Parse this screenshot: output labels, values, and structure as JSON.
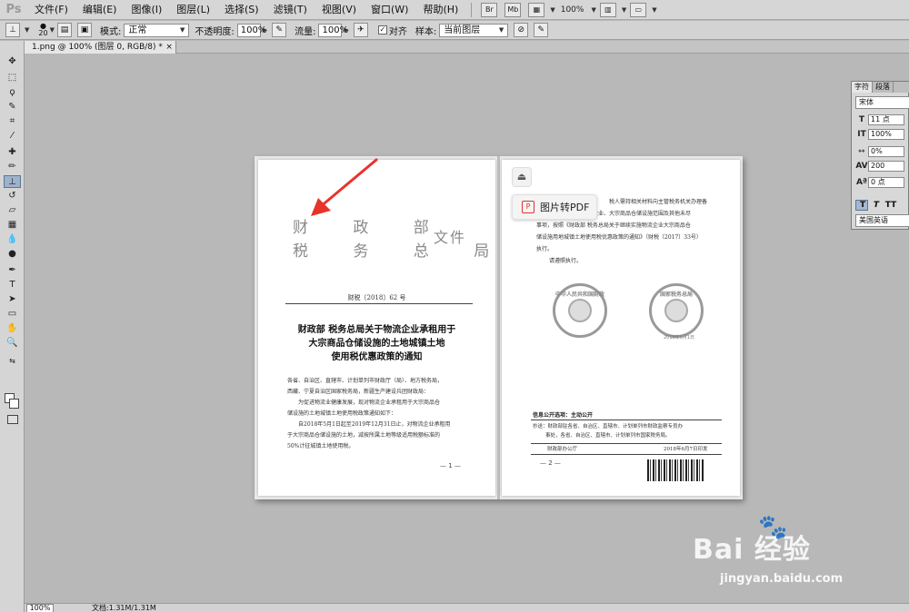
{
  "app": {
    "logo": "Ps"
  },
  "menu": {
    "items": [
      "文件(F)",
      "编辑(E)",
      "图像(I)",
      "图层(L)",
      "选择(S)",
      "滤镜(T)",
      "视图(V)",
      "窗口(W)",
      "帮助(H)"
    ],
    "buttons": [
      "Br",
      "Mb"
    ],
    "zoom": "100%"
  },
  "options": {
    "brush_size": "20",
    "mode_label": "模式:",
    "mode_value": "正常",
    "opacity_label": "不透明度:",
    "opacity_value": "100%",
    "flow_label": "流量:",
    "flow_value": "100%",
    "align_label": "对齐",
    "sample_label": "样本:",
    "sample_value": "当前图层"
  },
  "document_tab": {
    "label": "1.png @ 100% (图层 0, RGB/8) *",
    "close": "×"
  },
  "status": {
    "zoom": "100%",
    "doc_info": "文档:1.31M/1.31M"
  },
  "left_page": {
    "header_line1": "财  政  部",
    "header_line2": "税 务 总 局",
    "header_suffix": "文件",
    "doc_number": "财税〔2018〕62 号",
    "title_lines": [
      "财政部  税务总局关于物流企业承租用于",
      "大宗商品仓储设施的土地城镇土地",
      "使用税优惠政策的通知"
    ],
    "body": [
      "各省、自治区、直辖市、计划单列市财政厅（局）、地方税务局，",
      "西藏、宁夏自治区国家税务局，新疆生产建设兵团财政局：",
      "为促进物流业健康发展，现对物流企业承租用于大宗商品仓",
      "储设施的土地城镇土地使用税政策通知如下：",
      "自2018年5月1日起至2019年12月31日止，对物流企业承租用",
      "于大宗商品仓储设施的土地，减按所属土地等级适用税额标准的",
      "50%计征城镇土地使用税。"
    ],
    "page_number": "— 1 —"
  },
  "right_page": {
    "lines": [
      "税人需持相关材料向主管税务机关办理备",
      "本通知所称的物流企业、大宗商品仓储设施范围及其他未尽",
      "事项，按照《财政部  税务总局关于继续实施物流企业大宗商品仓",
      "储设施用地城镇土地使用税优惠政策的通知》（财税〔2017〕33号）",
      "执行。",
      "请遵照执行。"
    ],
    "seal_left": "中华人民共和国财政部",
    "seal_right": "国家税务总局",
    "seal_date": "2018年6月1日",
    "info_title": "信息公开选项：主动公开",
    "cc_lines": [
      "抄送：财政部驻各省、自治区、直辖市、计划单列市财政监察专员办",
      "事处，各省、自治区、直辖市、计划单列市国家税务局。"
    ],
    "issuer": "财政部办公厅",
    "issue_date": "2018年6月7日印发",
    "page_number": "— 2 —"
  },
  "overlay": {
    "pdf_button": "图片转PDF",
    "pdf_icon": "P"
  },
  "char_panel": {
    "tabs": [
      "字符",
      "段落"
    ],
    "font": "宋体",
    "size": "11 点",
    "scale": "100%",
    "tracking": "0%",
    "kerning": "200",
    "baseline": "0 点",
    "tt_buttons": [
      "T",
      "T",
      "TT"
    ],
    "language": "美国英语"
  },
  "watermark": {
    "logo": "Bai  经验",
    "url": "jingyan.baidu.com"
  },
  "colors": {
    "arrow": "#e8332a",
    "ui_bg": "#b8b8b8",
    "pdf_icon": "#d33333"
  }
}
